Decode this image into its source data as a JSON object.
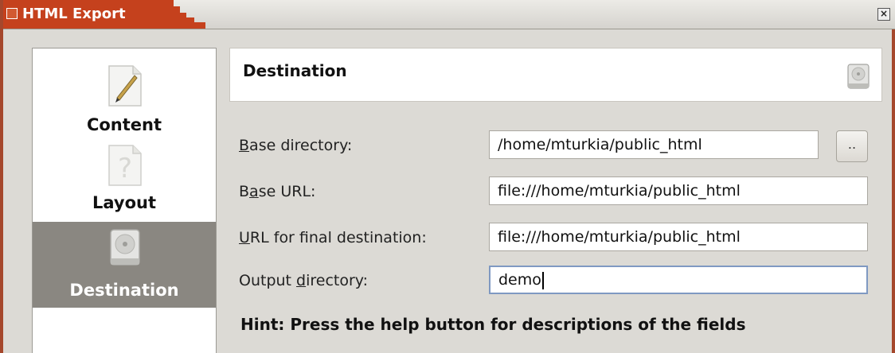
{
  "window": {
    "title": "HTML Export",
    "close_glyph": "×",
    "accent_color": "#c5411d"
  },
  "nav": {
    "items": [
      {
        "label": "Content",
        "icon": "pencil-icon",
        "active": false
      },
      {
        "label": "Layout",
        "icon": "question-icon",
        "active": false
      },
      {
        "label": "Destination",
        "icon": "harddisk-icon",
        "active": true
      }
    ],
    "active_color": "#8a8781"
  },
  "header": {
    "title": "Destination",
    "icon": "harddisk-icon"
  },
  "form": {
    "base_directory": {
      "label_mnemonic": "B",
      "label_rest": "ase directory:",
      "value": "/home/mturkia/public_html"
    },
    "browse_button": {
      "label": ".."
    },
    "base_url": {
      "label_pre": "B",
      "label_mnemonic": "a",
      "label_rest": "se URL:",
      "value": "file:///home/mturkia/public_html"
    },
    "final_url": {
      "label_mnemonic": "U",
      "label_rest": "RL for final destination:",
      "value": "file:///home/mturkia/public_html"
    },
    "output_directory": {
      "label_pre": "Output ",
      "label_mnemonic": "d",
      "label_rest": "irectory:",
      "value": "demo"
    }
  },
  "hint": "Hint: Press the help button for descriptions of the fields"
}
